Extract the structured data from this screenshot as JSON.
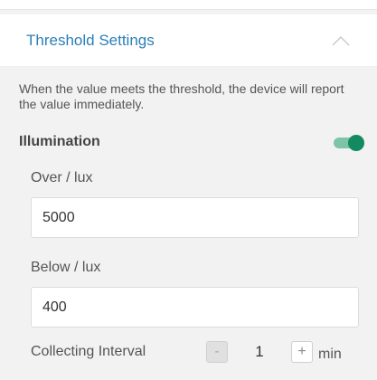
{
  "header": {
    "title": "Threshold Settings"
  },
  "description": "When the value meets the threshold, the device will report the value immediately.",
  "illumination": {
    "label": "Illumination",
    "enabled": true
  },
  "over": {
    "label": "Over / lux",
    "value": "5000"
  },
  "below": {
    "label": "Below / lux",
    "value": "400"
  },
  "interval": {
    "label": "Collecting Interval",
    "value": "1",
    "minus_label": "-",
    "plus_label": "+",
    "unit": "min"
  },
  "colors": {
    "accent": "#2a7fb8",
    "toggle_on": "#138a5f"
  },
  "icons": {
    "collapse": "chevron-up-icon"
  }
}
